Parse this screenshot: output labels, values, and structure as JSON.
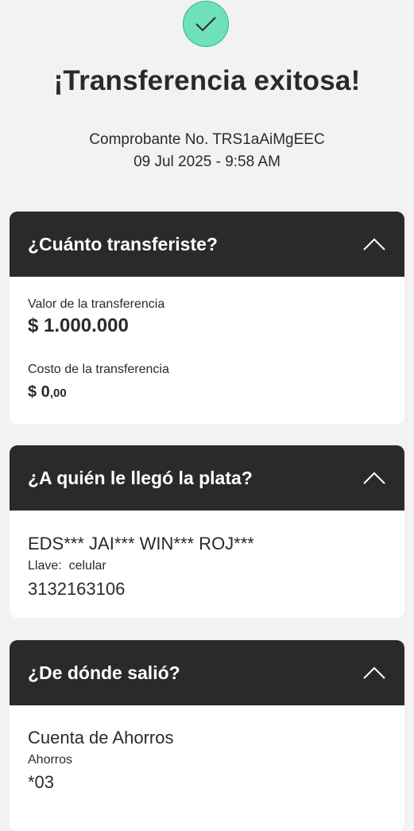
{
  "success_icon": "check-icon",
  "title": "¡Transferencia exitosa!",
  "receipt": {
    "number_text": "Comprobante No. TRS1aAiMgEEC",
    "datetime": "09 Jul 2025 - 9:58 AM"
  },
  "amount_section": {
    "header": "¿Cuánto transferiste?",
    "toggle_icon": "chevron-up-icon",
    "value_label": "Valor de la transferencia",
    "value": "$ 1.000.000",
    "cost_label": "Costo de la transferencia",
    "cost_main": "$ 0",
    "cost_cents": ",00"
  },
  "recipient_section": {
    "header": "¿A quién le llegó la plata?",
    "toggle_icon": "chevron-up-icon",
    "name": "EDS*** JAI*** WIN*** ROJ***",
    "key_label": "Llave:",
    "key_type": "celular",
    "phone": "3132163106"
  },
  "source_section": {
    "header": "¿De dónde salió?",
    "toggle_icon": "chevron-up-icon",
    "account_name": "Cuenta de Ahorros",
    "account_type": "Ahorros",
    "account_number": "*03"
  },
  "colors": {
    "background": "#f2f2f2",
    "header_dark": "#2c2a29",
    "success_green": "#6ee1b9",
    "card": "#ffffff"
  }
}
